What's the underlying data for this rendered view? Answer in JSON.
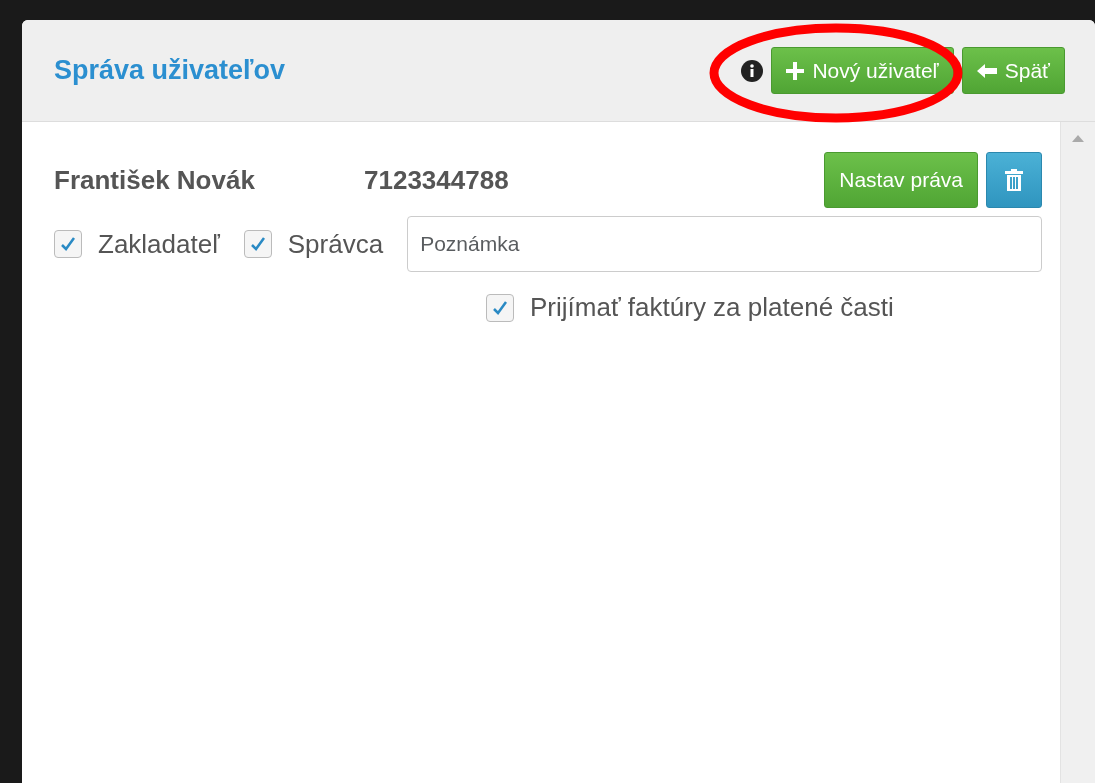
{
  "header": {
    "title": "Správa uživateľov",
    "buttons": [
      {
        "kind": "add",
        "label": "Nový uživateľ"
      },
      {
        "kind": "back",
        "label": "Späť"
      }
    ]
  },
  "users": [
    {
      "name": "František Novák",
      "id_number": "7123344788",
      "rights_button": "Nastav práva",
      "roles": [
        {
          "label": "Zakladateľ",
          "checked": true
        },
        {
          "label": "Správca",
          "checked": true
        }
      ],
      "note": {
        "placeholder": "Poznámka"
      },
      "invoices": {
        "label": "Prijímať faktúry za platené časti",
        "checked": true
      }
    }
  ]
}
